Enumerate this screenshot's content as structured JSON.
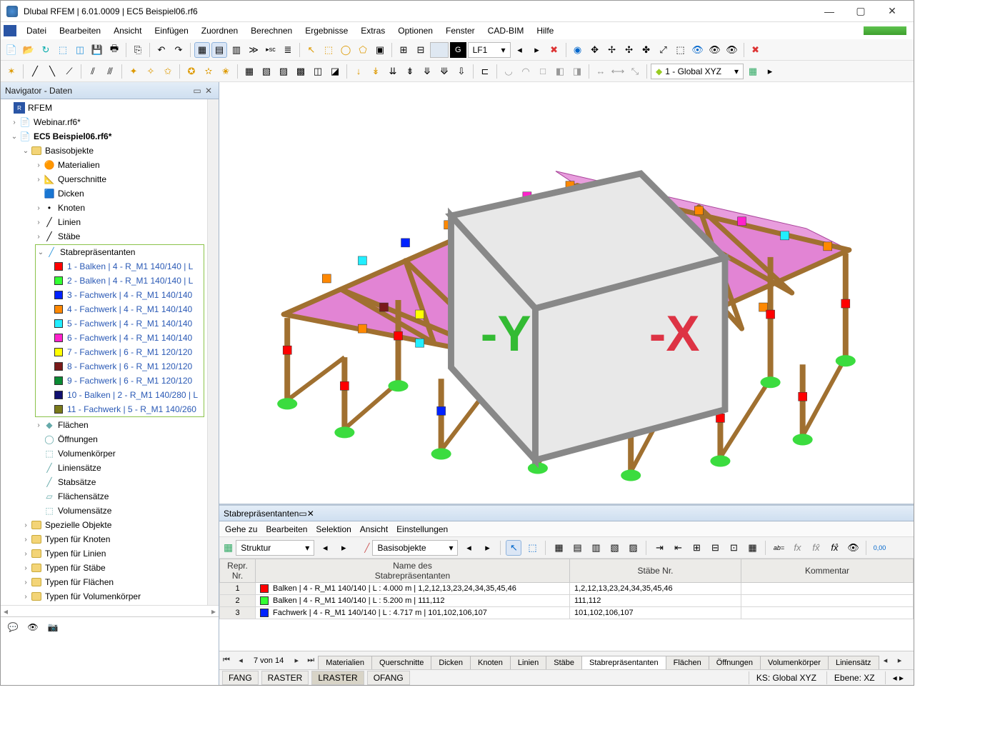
{
  "app": {
    "title": "Dlubal RFEM | 6.01.0009 | EC5 Beispiel06.rf6"
  },
  "menu": [
    "Datei",
    "Bearbeiten",
    "Ansicht",
    "Einfügen",
    "Zuordnen",
    "Berechnen",
    "Ergebnisse",
    "Extras",
    "Optionen",
    "Fenster",
    "CAD-BIM",
    "Hilfe"
  ],
  "toolbar1": {
    "g_label": "G",
    "lf_label": "LF1"
  },
  "toolbar2": {
    "coord_combo": "1 - Global XYZ"
  },
  "navigator": {
    "title": "Navigator - Daten",
    "root": "RFEM",
    "items": [
      {
        "label": "Webinar.rf6*"
      },
      {
        "label": "EC5 Beispiel06.rf6*",
        "bold": true
      }
    ],
    "basis": "Basisobjekte",
    "basis_children": [
      "Materialien",
      "Querschnitte",
      "Dicken",
      "Knoten",
      "Linien",
      "Stäbe"
    ],
    "stab_label": "Stabrepräsentanten",
    "stab_items": [
      {
        "c": "#ff0000",
        "t": "1 - Balken | 4 - R_M1 140/140 | L"
      },
      {
        "c": "#33ff33",
        "t": "2 - Balken | 4 - R_M1 140/140 | L"
      },
      {
        "c": "#0022ff",
        "t": "3 - Fachwerk | 4 - R_M1 140/140"
      },
      {
        "c": "#ff8800",
        "t": "4 - Fachwerk | 4 - R_M1 140/140"
      },
      {
        "c": "#22eeff",
        "t": "5 - Fachwerk | 4 - R_M1 140/140"
      },
      {
        "c": "#ff22cc",
        "t": "6 - Fachwerk | 4 - R_M1 140/140"
      },
      {
        "c": "#ffff00",
        "t": "7 - Fachwerk | 6 - R_M1 120/120"
      },
      {
        "c": "#7a1a1a",
        "t": "8 - Fachwerk | 6 - R_M1 120/120"
      },
      {
        "c": "#0a8a33",
        "t": "9 - Fachwerk | 6 - R_M1 120/120"
      },
      {
        "c": "#101070",
        "t": "10 - Balken | 2 - R_M1 140/280 | L"
      },
      {
        "c": "#7a7a1a",
        "t": "11 - Fachwerk | 5 - R_M1 140/260"
      }
    ],
    "after_stab": [
      "Flächen",
      "Öffnungen",
      "Volumenkörper",
      "Liniensätze",
      "Stabsätze",
      "Flächensätze",
      "Volumensätze"
    ],
    "top_folders": [
      "Spezielle Objekte",
      "Typen für Knoten",
      "Typen für Linien",
      "Typen für Stäbe",
      "Typen für Flächen",
      "Typen für Volumenkörper"
    ]
  },
  "bottom": {
    "title": "Stabrepräsentanten",
    "menu": [
      "Gehe zu",
      "Bearbeiten",
      "Selektion",
      "Ansicht",
      "Einstellungen"
    ],
    "combo1": "Struktur",
    "combo2": "Basisobjekte",
    "headers": {
      "c1": "Repr.\nNr.",
      "c2": "Name des\nStabrepräsentanten",
      "c3": "Stäbe Nr.",
      "c4": "Kommentar"
    },
    "rows": [
      {
        "n": "1",
        "c": "#ff0000",
        "name": "Balken | 4 - R_M1 140/140 | L : 4.000 m | 1,2,12,13,23,24,34,35,45,46",
        "staebe": "1,2,12,13,23,24,34,35,45,46"
      },
      {
        "n": "2",
        "c": "#33ff33",
        "name": "Balken | 4 - R_M1 140/140 | L : 5.200 m | 111,112",
        "staebe": "111,112"
      },
      {
        "n": "3",
        "c": "#0022ff",
        "name": "Fachwerk | 4 - R_M1 140/140 | L : 4.717 m | 101,102,106,107",
        "staebe": "101,102,106,107"
      }
    ],
    "pager": "7 von 14",
    "tabs": [
      "Materialien",
      "Querschnitte",
      "Dicken",
      "Knoten",
      "Linien",
      "Stäbe",
      "Stabrepräsentanten",
      "Flächen",
      "Öffnungen",
      "Volumenkörper",
      "Liniensätz"
    ],
    "active_tab": 6
  },
  "status": {
    "btns": [
      "FANG",
      "RASTER",
      "LRASTER",
      "OFANG"
    ],
    "ks": "KS: Global XYZ",
    "ebene": "Ebene: XZ"
  }
}
